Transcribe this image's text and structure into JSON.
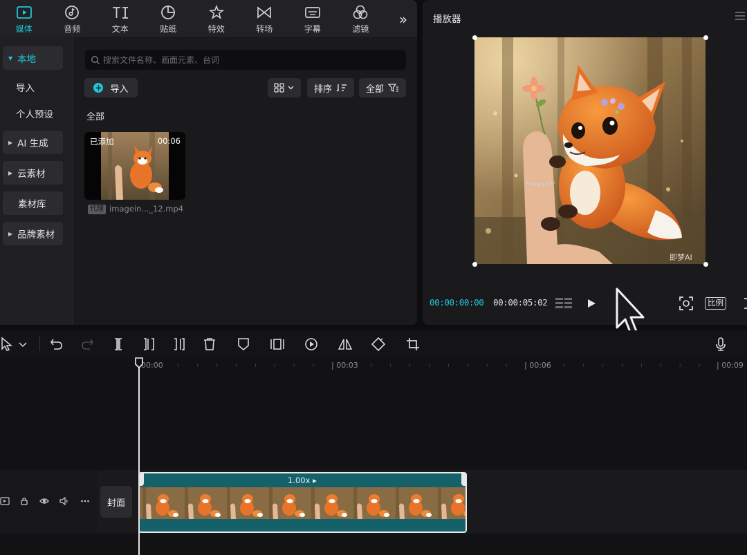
{
  "top_tabs": [
    {
      "label": "媒体",
      "icon": "media-icon"
    },
    {
      "label": "音频",
      "icon": "audio-icon"
    },
    {
      "label": "文本",
      "icon": "text-icon"
    },
    {
      "label": "贴纸",
      "icon": "sticker-icon"
    },
    {
      "label": "特效",
      "icon": "effects-icon"
    },
    {
      "label": "转场",
      "icon": "transition-icon"
    },
    {
      "label": "字幕",
      "icon": "subtitle-icon"
    },
    {
      "label": "滤镜",
      "icon": "filter-icon"
    }
  ],
  "sidebar": {
    "items": [
      {
        "label": "本地"
      },
      {
        "label": "导入"
      },
      {
        "label": "个人预设"
      },
      {
        "label": "AI 生成"
      },
      {
        "label": "云素材"
      },
      {
        "label": "素材库"
      },
      {
        "label": "品牌素材"
      }
    ]
  },
  "search": {
    "placeholder": "搜索文件名称、画面元素、台词"
  },
  "toolbar": {
    "import_label": "导入",
    "sort_label": "排序",
    "filter_label": "全部"
  },
  "media": {
    "section_title": "全部",
    "items": [
      {
        "added_label": "已添加",
        "duration": "00:06",
        "proxy_badge": "代理",
        "filename": "imagein..._12.mp4"
      }
    ]
  },
  "player": {
    "title": "播放器",
    "current_time": "00:00:00:00",
    "total_time": "00:00:05:02",
    "ratio_label": "比例",
    "watermark": "即梦AI"
  },
  "timeline": {
    "ruler_labels": [
      "00:00",
      "| 00:03",
      "| 00:06",
      "| 00:09"
    ],
    "cover_label": "封面",
    "clip_speed": "1.00x ▸"
  },
  "colors": {
    "accent": "#1fc6d6",
    "clip": "#14616a",
    "panel": "#1a1a1d"
  }
}
